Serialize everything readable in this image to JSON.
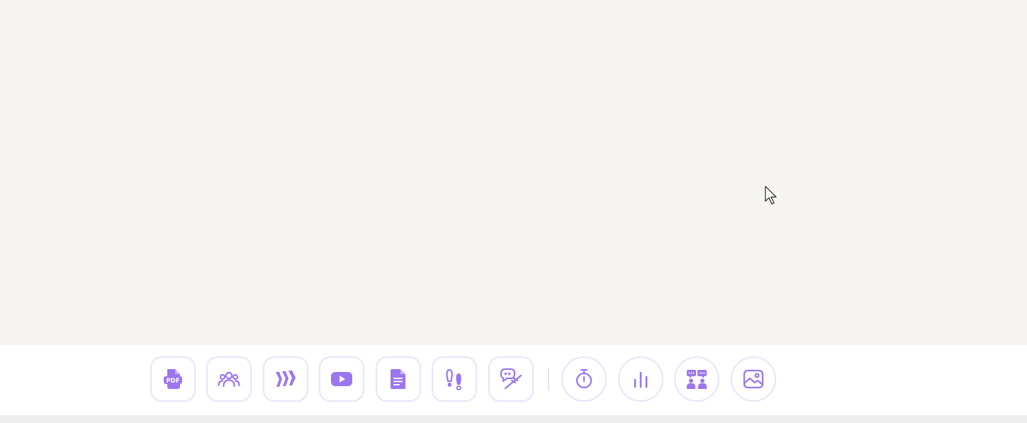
{
  "colors": {
    "canvas": "#f5f4f0",
    "toolbar": "#ffffff",
    "accent": "#9b76ee",
    "button_border": "#e7e3fb"
  },
  "toolbar": {
    "content_tools": [
      {
        "icon": "pdf-icon"
      },
      {
        "icon": "group-icon"
      },
      {
        "icon": "slides-icon"
      },
      {
        "icon": "youtube-icon"
      },
      {
        "icon": "document-icon"
      },
      {
        "icon": "footsteps-icon"
      },
      {
        "icon": "chat-slash-icon"
      }
    ],
    "activity_tools": [
      {
        "icon": "stopwatch-icon"
      },
      {
        "icon": "bar-chart-icon"
      },
      {
        "icon": "discussion-icon"
      },
      {
        "icon": "image-icon"
      }
    ]
  }
}
